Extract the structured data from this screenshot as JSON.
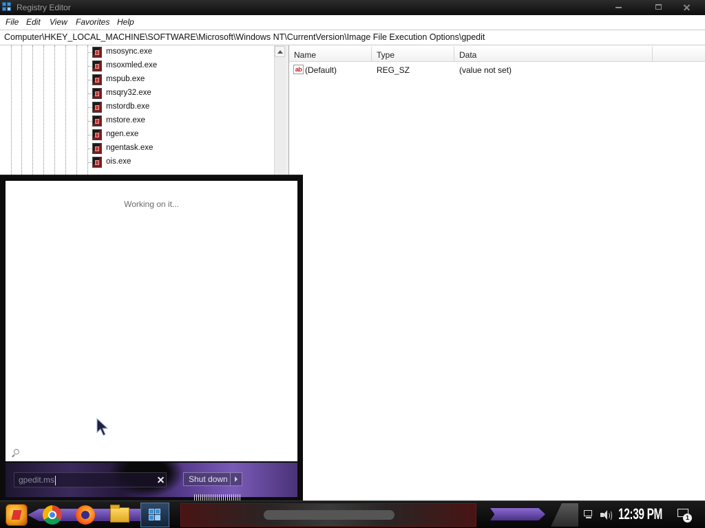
{
  "window": {
    "title": "Registry Editor"
  },
  "menu": [
    "File",
    "Edit",
    "View",
    "Favorites",
    "Help"
  ],
  "address": "Computer\\HKEY_LOCAL_MACHINE\\SOFTWARE\\Microsoft\\Windows NT\\CurrentVersion\\Image File Execution Options\\gpedit",
  "tree": {
    "items": [
      "msosync.exe",
      "msoxmled.exe",
      "mspub.exe",
      "msqry32.exe",
      "mstordb.exe",
      "mstore.exe",
      "ngen.exe",
      "ngentask.exe",
      "ois.exe"
    ]
  },
  "values": {
    "columns": {
      "name": "Name",
      "type": "Type",
      "data": "Data"
    },
    "rows": [
      {
        "icon": "string-value-icon",
        "icon_text": "ab",
        "name": "(Default)",
        "type": "REG_SZ",
        "data": "(value not set)"
      }
    ]
  },
  "start_menu": {
    "status": "Working on it...",
    "search_value": "gpedit.ms",
    "shutdown_label": "Shut down"
  },
  "taskbar": {
    "pinned": [
      "start-orb-icon",
      "chrome-icon",
      "firefox-icon",
      "file-explorer-icon",
      "registry-editor-icon"
    ],
    "active": "registry-editor-icon",
    "tray": [
      "network-icon",
      "volume-icon",
      "action-center-icon"
    ],
    "clock": "12:39 PM",
    "notification_count": "1"
  },
  "colors": {
    "accent": "#3b8fd8",
    "taskbar_skin": "#6a4aa8",
    "title_bar": "#1a1a1a"
  }
}
